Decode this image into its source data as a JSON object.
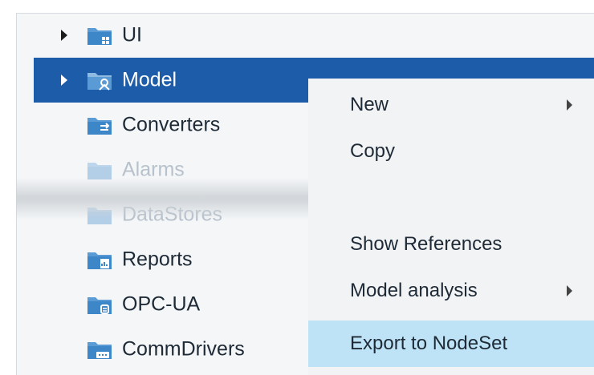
{
  "colors": {
    "selection": "#1c5ca8",
    "menu_highlight": "#bfe3f6",
    "folder_blue": "#3d87c9"
  },
  "tree": {
    "items": [
      {
        "label": "UI",
        "icon": "ui-folder-icon",
        "expandable": true,
        "selected": false
      },
      {
        "label": "Model",
        "icon": "model-folder-icon",
        "expandable": true,
        "selected": true
      },
      {
        "label": "Converters",
        "icon": "converters-folder-icon",
        "expandable": false,
        "selected": false
      },
      {
        "label": "Alarms",
        "icon": "alarms-folder-icon",
        "expandable": false,
        "selected": false
      },
      {
        "label": "DataStores",
        "icon": "datastores-folder-icon",
        "expandable": false,
        "selected": false
      },
      {
        "label": "Reports",
        "icon": "reports-folder-icon",
        "expandable": false,
        "selected": false
      },
      {
        "label": "OPC-UA",
        "icon": "opcua-folder-icon",
        "expandable": false,
        "selected": false
      },
      {
        "label": "CommDrivers",
        "icon": "commdrivers-folder-icon",
        "expandable": false,
        "selected": false
      }
    ]
  },
  "context_menu": {
    "items": [
      {
        "label": "New",
        "submenu": true,
        "highlighted": false
      },
      {
        "label": "Copy",
        "submenu": false,
        "highlighted": false
      },
      {
        "label": "Show References",
        "submenu": false,
        "highlighted": false
      },
      {
        "label": "Model analysis",
        "submenu": true,
        "highlighted": false
      },
      {
        "label": "Export to NodeSet",
        "submenu": false,
        "highlighted": true
      }
    ]
  }
}
